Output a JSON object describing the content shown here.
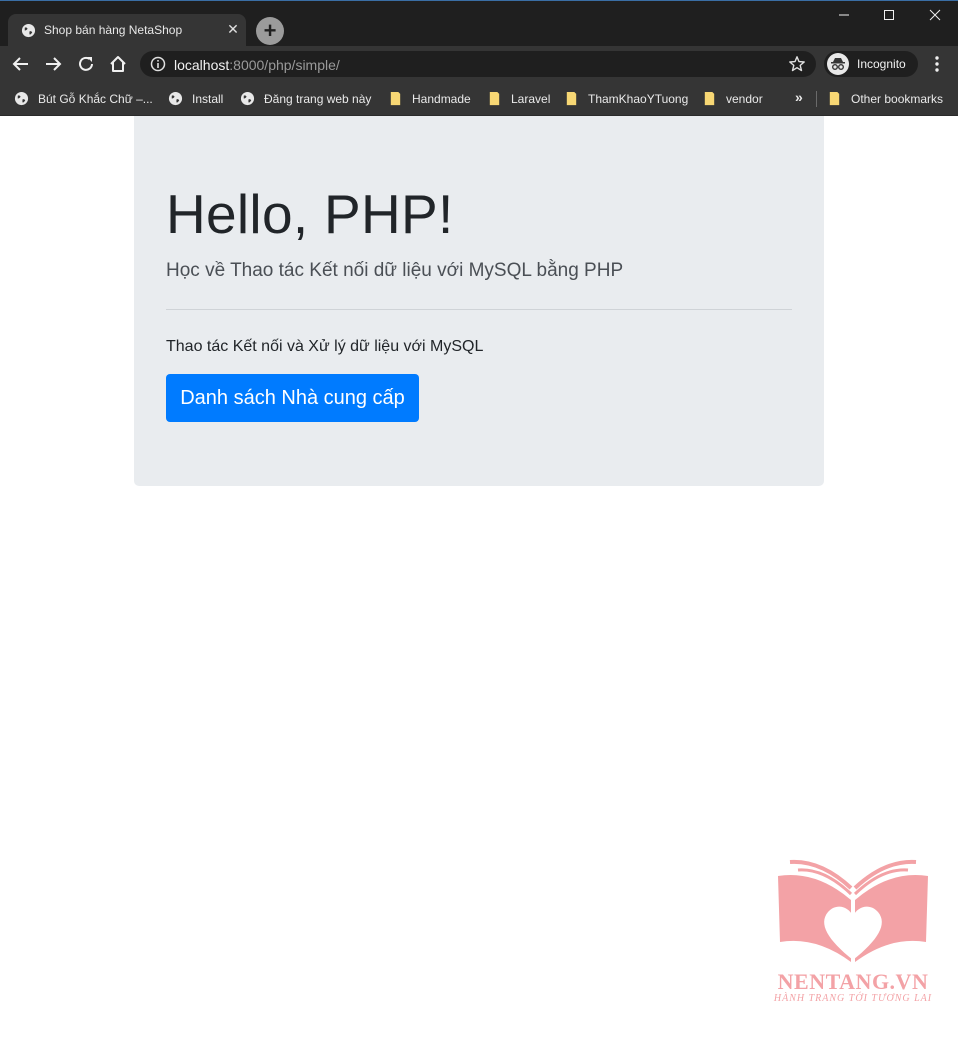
{
  "browser": {
    "tab": {
      "title": "Shop bán hàng NetaShop",
      "favicon": "globe-icon",
      "close": "✕"
    },
    "new_tab": "+",
    "window_controls": [
      "minimize-icon",
      "maximize-icon",
      "close-icon"
    ],
    "url": {
      "host": "localhost",
      "path": ":8000/php/simple/"
    },
    "incognito_label": "Incognito",
    "bookmarks": [
      {
        "label": "Bút Gỗ Khắc Chữ –...",
        "icon": "globe-icon"
      },
      {
        "label": "Install",
        "icon": "globe-icon"
      },
      {
        "label": "Đăng trang web này",
        "icon": "globe-icon"
      },
      {
        "label": "Handmade",
        "icon": "folder-icon"
      },
      {
        "label": "Laravel",
        "icon": "folder-icon"
      },
      {
        "label": "ThamKhaoYTuong",
        "icon": "folder-icon"
      },
      {
        "label": "vendor",
        "icon": "folder-icon"
      }
    ],
    "bookmarks_more": "»",
    "other_bookmarks": "Other bookmarks"
  },
  "page": {
    "heading": "Hello, PHP!",
    "lead": "Học về Thao tác Kết nối dữ liệu với MySQL bằng PHP",
    "paragraph": "Thao tác Kết nối và Xử lý dữ liệu với MySQL",
    "button_label": "Danh sách Nhà cung cấp"
  },
  "watermark": {
    "name": "NENTANG.VN",
    "slogan": "HÀNH TRANG TỚI TƯƠNG LAI"
  },
  "colors": {
    "chrome_dark": "#1f1f1f",
    "chrome_toolbar": "#353535",
    "jumbotron_bg": "#e9ecef",
    "primary": "#007bff",
    "watermark": "#f3a2a6"
  }
}
